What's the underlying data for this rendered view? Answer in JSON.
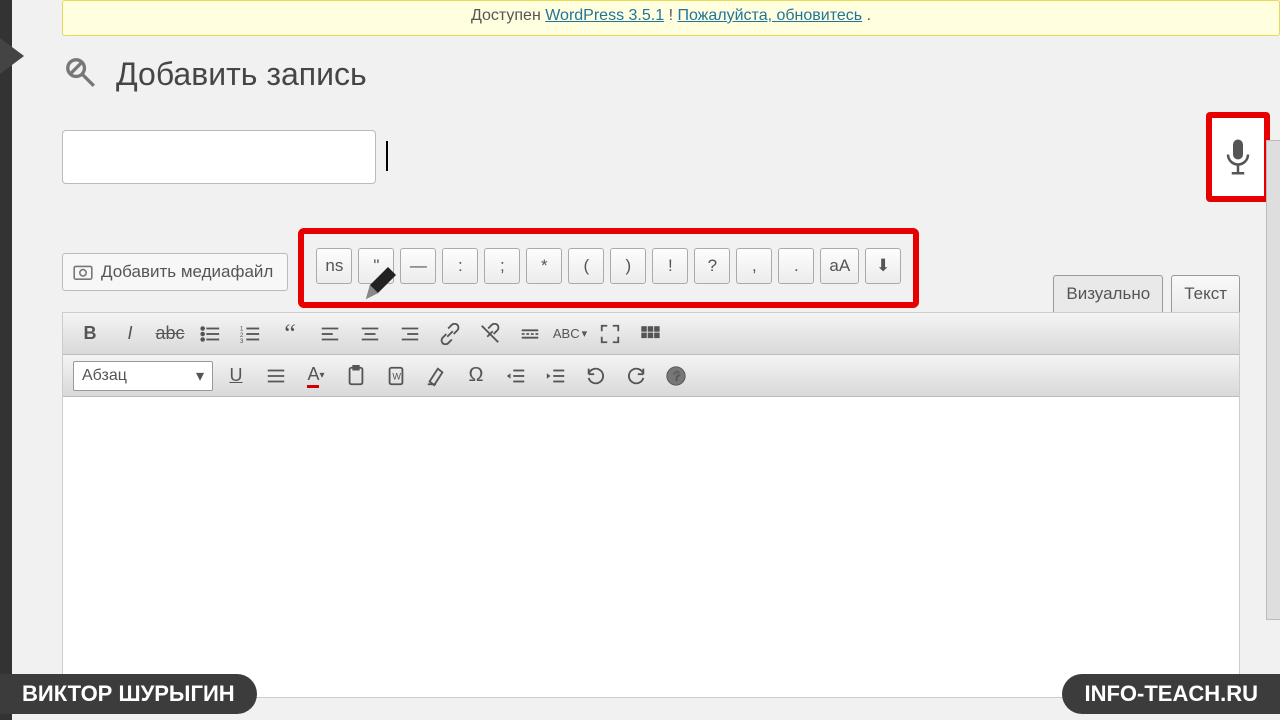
{
  "notice": {
    "prefix": "Доступен ",
    "link1": "WordPress 3.5.1",
    "mid": "! ",
    "link2": "Пожалуйста, обновитесь",
    "suffix": "."
  },
  "page_title": "Добавить запись",
  "title_input": {
    "value": "",
    "placeholder": ""
  },
  "media_button": "Добавить медиафайл",
  "punct": [
    "ns",
    "\"",
    "—",
    ":",
    ";",
    "*",
    "(",
    ")",
    "!",
    "?",
    ",",
    ".",
    "аА",
    "⬇"
  ],
  "tabs": {
    "visual": "Визуально",
    "text": "Текст"
  },
  "format_select": "Абзац",
  "banners": {
    "left": "ВИКТОР ШУРЫГИН",
    "right": "INFO-TEACH.RU"
  }
}
